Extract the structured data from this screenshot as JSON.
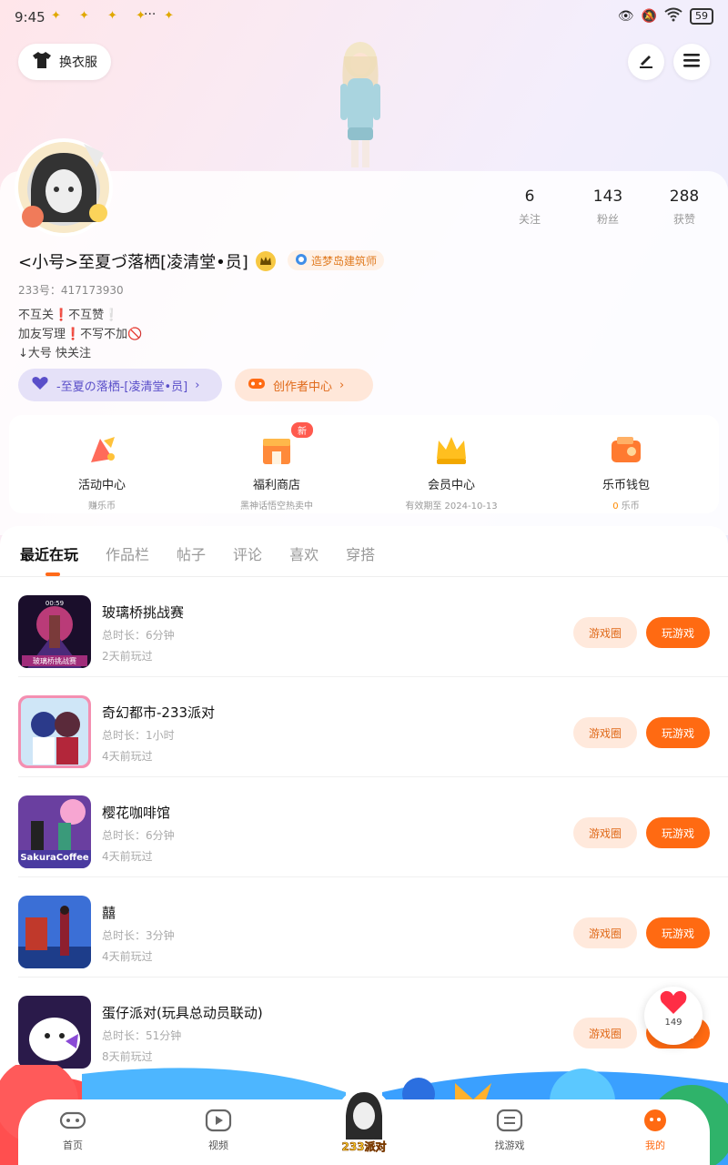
{
  "status_bar": {
    "time": "9:45",
    "battery": "59",
    "more": "···",
    "signal": "6"
  },
  "top": {
    "dress_label": "换衣服"
  },
  "profile": {
    "name": "<小号>至夏づ落栖[凌清堂•员]",
    "title_badge": "造梦岛建筑师",
    "uid": "233号：417173930",
    "bio": "不互关❗不互赞❕\n加友写理❗不写不加🚫\n↓大号 快关注",
    "stats": [
      {
        "num": "6",
        "label": "关注"
      },
      {
        "num": "143",
        "label": "粉丝"
      },
      {
        "num": "288",
        "label": "获赞"
      }
    ],
    "group_pill": "-至夏の落栖-[凌清堂•员]",
    "creator_pill": "创作者中心"
  },
  "features": [
    {
      "title": "活动中心",
      "sub": "赚乐币",
      "icon": "activity-icon"
    },
    {
      "title": "福利商店",
      "sub": "黑神话悟空热卖中",
      "icon": "shop-icon",
      "badge": "新"
    },
    {
      "title": "会员中心",
      "sub": "有效期至 2024-10-13",
      "icon": "crown-icon"
    },
    {
      "title": "乐币钱包",
      "sub_num": "0",
      "sub_unit": "乐币",
      "icon": "wallet-icon"
    }
  ],
  "tabs": [
    "最近在玩",
    "作品栏",
    "帖子",
    "评论",
    "喜欢",
    "穿搭"
  ],
  "games": [
    {
      "name": "玻璃桥挑战赛",
      "duration": "总时长：6分钟",
      "ago": "2天前玩过"
    },
    {
      "name": "奇幻都市-233派对",
      "duration": "总时长：1小时",
      "ago": "4天前玩过"
    },
    {
      "name": "樱花咖啡馆",
      "duration": "总时长：6分钟",
      "ago": "4天前玩过"
    },
    {
      "name": "囍",
      "duration": "总时长：3分钟",
      "ago": "4天前玩过"
    },
    {
      "name": "蛋仔派对(玩具总动员联动)",
      "duration": "总时长：51分钟",
      "ago": "8天前玩过"
    }
  ],
  "game_buttons": {
    "circle": "游戏圈",
    "play": "玩游戏"
  },
  "thumb_texts": {
    "g1_top": "00:59",
    "g1_bottom": "玻璃桥挑战赛",
    "g3": "SakuraCoffee"
  },
  "float_like": {
    "count": "149"
  },
  "nav": {
    "home": "首页",
    "video": "视频",
    "center": "233派对",
    "find": "找游戏",
    "mine": "我的"
  },
  "colors": {
    "accent": "#ff6a12",
    "accent_light": "#ffe9dc",
    "purple": "#5a4fc9"
  }
}
